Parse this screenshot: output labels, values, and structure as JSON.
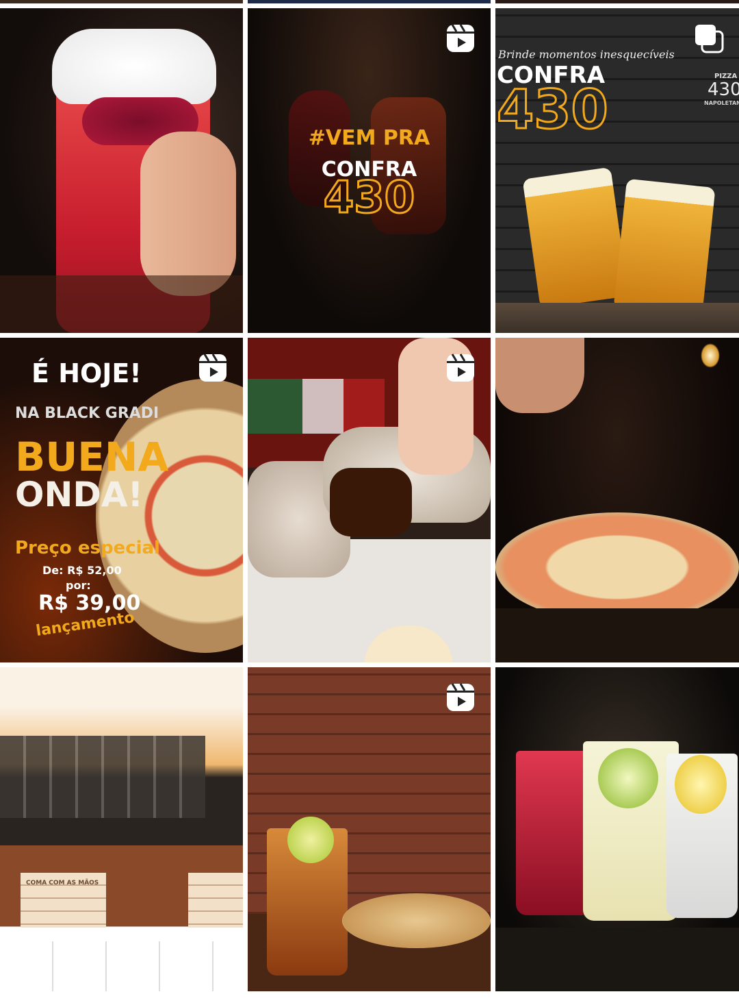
{
  "grid": {
    "posts": [
      {
        "media": "image",
        "caption_lines": []
      },
      {
        "media": "reel",
        "caption_lines": [
          "#VEM PRA",
          "CONFRA",
          "430"
        ]
      },
      {
        "media": "carousel",
        "caption_lines": [
          "Brinde momentos inesquecíveis",
          "CONFRA",
          "430",
          "PIZZA",
          "430",
          "NAPOLETANA"
        ]
      },
      {
        "media": "reel",
        "caption_lines": [
          "É HOJE!",
          "NA BLACK GRADI",
          "BUENA",
          "ONDA!",
          "Preço especial",
          "De: R$ 52,00",
          "por:",
          "R$ 39,00",
          "lançamento"
        ]
      },
      {
        "media": "reel",
        "caption_lines": []
      },
      {
        "media": "image",
        "caption_lines": []
      },
      {
        "media": "image",
        "caption_lines": [
          "COMA COM AS MÃOS"
        ]
      },
      {
        "media": "reel",
        "caption_lines": []
      },
      {
        "media": "image",
        "caption_lines": []
      }
    ]
  },
  "icons": {
    "reel": "reel-icon",
    "carousel": "carousel-icon"
  },
  "colors": {
    "accent_yellow": "#f2a91c",
    "orange": "#f08a1e",
    "background": "#ffffff"
  }
}
